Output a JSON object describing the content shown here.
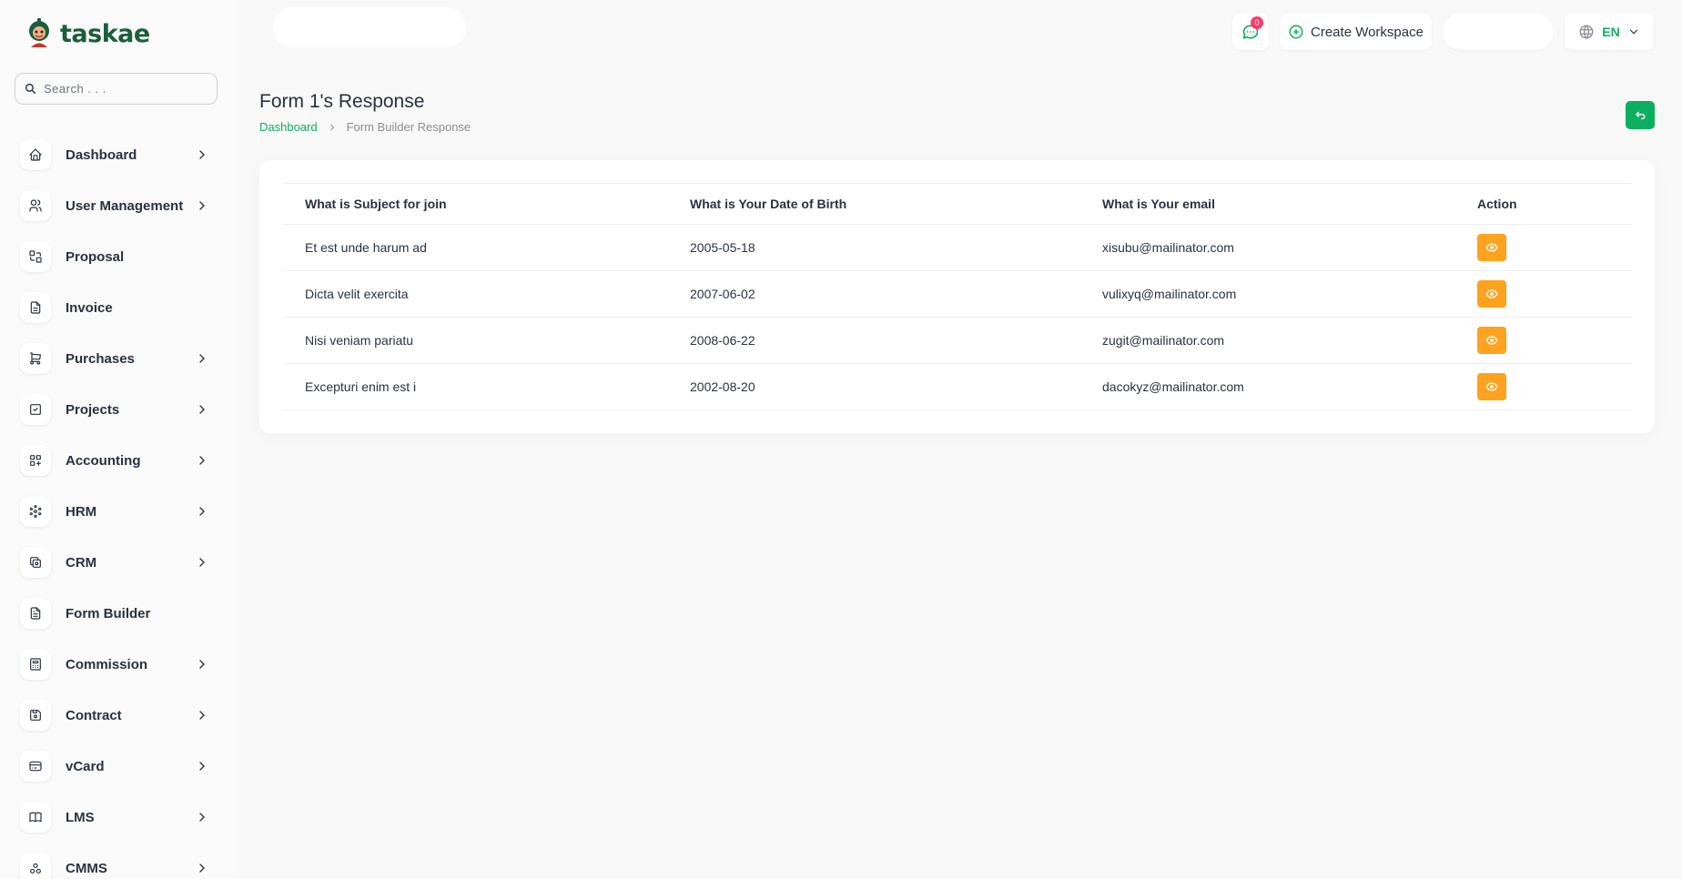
{
  "app": {
    "name": "taskae"
  },
  "search": {
    "placeholder": "Search . . ."
  },
  "sidebar": {
    "items": [
      {
        "label": "Dashboard",
        "icon": "home-icon",
        "chevron": true
      },
      {
        "label": "User Management",
        "icon": "users-icon",
        "chevron": true
      },
      {
        "label": "Proposal",
        "icon": "proposal-icon",
        "chevron": false
      },
      {
        "label": "Invoice",
        "icon": "file-invoice-icon",
        "chevron": false
      },
      {
        "label": "Purchases",
        "icon": "shopping-cart-icon",
        "chevron": true
      },
      {
        "label": "Projects",
        "icon": "square-check-icon",
        "chevron": true
      },
      {
        "label": "Accounting",
        "icon": "layout-grid-add-icon",
        "chevron": true
      },
      {
        "label": "HRM",
        "icon": "hrm-icon",
        "chevron": true
      },
      {
        "label": "CRM",
        "icon": "crm-icon",
        "chevron": true
      },
      {
        "label": "Form Builder",
        "icon": "file-text-icon",
        "chevron": false
      },
      {
        "label": "Commission",
        "icon": "calculator-icon",
        "chevron": true
      },
      {
        "label": "Contract",
        "icon": "device-floppy-icon",
        "chevron": true
      },
      {
        "label": "vCard",
        "icon": "credit-card-icon",
        "chevron": true
      },
      {
        "label": "LMS",
        "icon": "book-icon",
        "chevron": true
      },
      {
        "label": "CMMS",
        "icon": "cmms-icon",
        "chevron": true
      }
    ]
  },
  "header": {
    "message_badge": "0",
    "create_workspace_label": "Create Workspace",
    "language": "EN"
  },
  "page": {
    "title": "Form 1's Response",
    "breadcrumb": {
      "home": "Dashboard",
      "current": "Form Builder Response"
    }
  },
  "table": {
    "headers": [
      "What is Subject for join",
      "What is Your Date of Birth",
      "What is Your email",
      "Action"
    ],
    "rows": [
      {
        "subject": "Et est unde harum ad",
        "dob": "2005-05-18",
        "email": "xisubu@mailinator.com"
      },
      {
        "subject": "Dicta velit exercita",
        "dob": "2007-06-02",
        "email": "vulixyq@mailinator.com"
      },
      {
        "subject": "Nisi veniam pariatu",
        "dob": "2008-06-22",
        "email": "zugit@mailinator.com"
      },
      {
        "subject": "Excepturi enim est i",
        "dob": "2002-08-20",
        "email": "dacokyz@mailinator.com"
      }
    ]
  },
  "colors": {
    "accent": "#0caf60",
    "action": "#ffa21d",
    "badge": "#ff3a6e"
  }
}
